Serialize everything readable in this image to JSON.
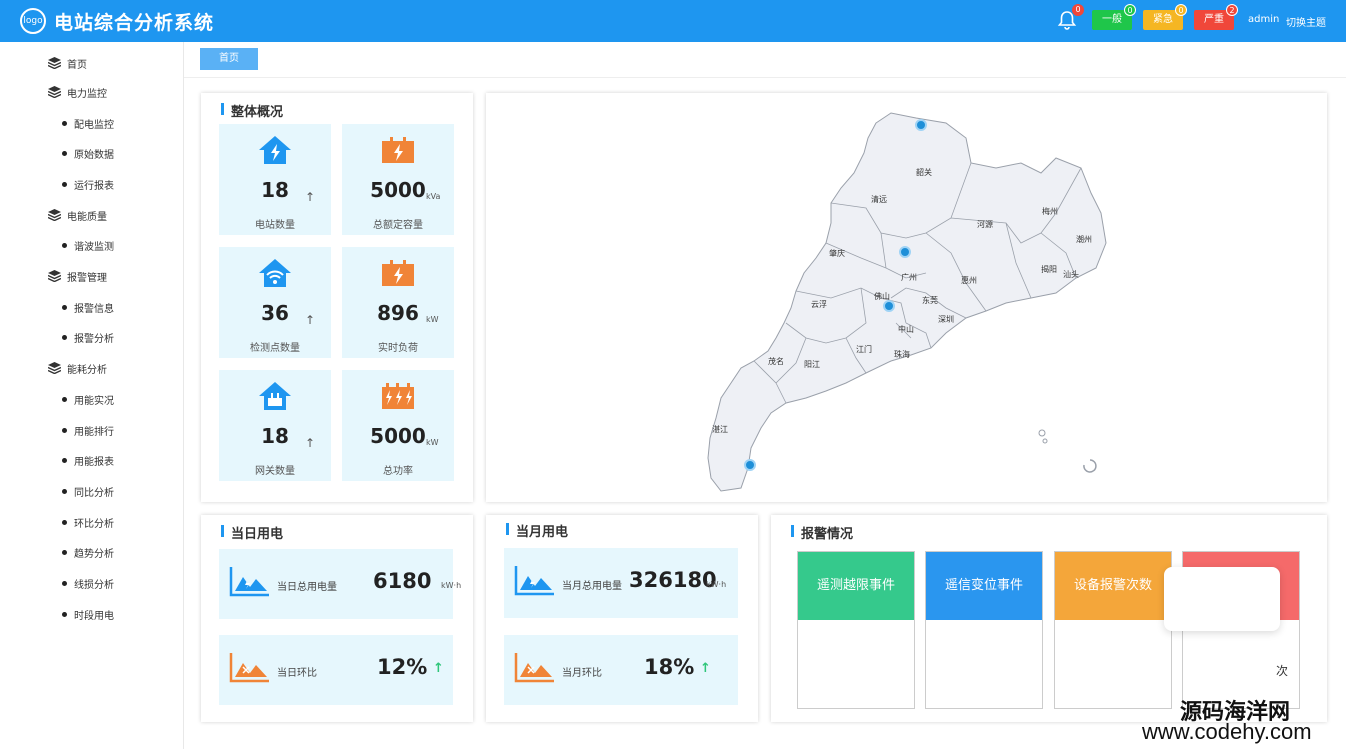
{
  "app": {
    "logo_text": "logo",
    "title": "电站综合分析系统"
  },
  "header": {
    "bell_count": "0",
    "alerts": [
      {
        "label": "一般",
        "count": "0",
        "color": "#1fc64a"
      },
      {
        "label": "紧急",
        "count": "0",
        "color": "#f5b623"
      },
      {
        "label": "严重",
        "count": "2",
        "color": "#f0473a"
      }
    ],
    "user": "admin",
    "theme_switch": "切换主题"
  },
  "sidebar": {
    "items": [
      {
        "label": "首页",
        "level": "top"
      },
      {
        "label": "电力监控",
        "level": "top"
      },
      {
        "label": "配电监控",
        "level": "sub"
      },
      {
        "label": "原始数据",
        "level": "sub"
      },
      {
        "label": "运行报表",
        "level": "sub"
      },
      {
        "label": "电能质量",
        "level": "top"
      },
      {
        "label": "谐波监测",
        "level": "sub"
      },
      {
        "label": "报警管理",
        "level": "top"
      },
      {
        "label": "报警信息",
        "level": "sub"
      },
      {
        "label": "报警分析",
        "level": "sub"
      },
      {
        "label": "能耗分析",
        "level": "top"
      },
      {
        "label": "用能实况",
        "level": "sub"
      },
      {
        "label": "用能排行",
        "level": "sub"
      },
      {
        "label": "用能报表",
        "level": "sub"
      },
      {
        "label": "同比分析",
        "level": "sub"
      },
      {
        "label": "环比分析",
        "level": "sub"
      },
      {
        "label": "趋势分析",
        "level": "sub"
      },
      {
        "label": "线损分析",
        "level": "sub"
      },
      {
        "label": "时段用电",
        "level": "sub"
      }
    ]
  },
  "tabs": {
    "home": "首页"
  },
  "overview": {
    "title": "整体概况",
    "tiles": [
      {
        "value": "18",
        "unit": "",
        "arrow": "↑",
        "label": "电站数量",
        "icon": "house-power-icon"
      },
      {
        "value": "5000",
        "unit": "kVa",
        "arrow": "",
        "label": "总额定容量",
        "icon": "battery-bolt-icon"
      },
      {
        "value": "36",
        "unit": "",
        "arrow": "↑",
        "label": "检测点数量",
        "icon": "house-wifi-icon"
      },
      {
        "value": "896",
        "unit": "kW",
        "arrow": "",
        "label": "实时负荷",
        "icon": "battery-bolt-icon"
      },
      {
        "value": "18",
        "unit": "",
        "arrow": "↑",
        "label": "网关数量",
        "icon": "house-gateway-icon"
      },
      {
        "value": "5000",
        "unit": "kW",
        "arrow": "",
        "label": "总功率",
        "icon": "battery-triple-bolt-icon"
      }
    ]
  },
  "map": {
    "cities": [
      "韶关",
      "清远",
      "河源",
      "梅州",
      "潮州",
      "肇庆",
      "广州",
      "惠州",
      "揭阳",
      "汕头",
      "云浮",
      "佛山",
      "东莞",
      "中山",
      "深圳",
      "江门",
      "珠海",
      "茂名",
      "阳江",
      "湛江"
    ]
  },
  "daily": {
    "title": "当日用电",
    "total_label": "当日总用电量",
    "total_value": "6180",
    "total_unit": "kW·h",
    "ratio_label": "当日环比",
    "ratio_value": "12%",
    "ratio_arrow": "↑"
  },
  "monthly": {
    "title": "当月用电",
    "total_label": "当月总用电量",
    "total_value": "326180",
    "total_unit": "kW·h",
    "ratio_label": "当月环比",
    "ratio_value": "18%",
    "ratio_arrow": "↑"
  },
  "alarms": {
    "title": "报警情况",
    "cards": [
      {
        "label": "遥测越限事件",
        "color": "#35c98c"
      },
      {
        "label": "遥信变位事件",
        "color": "#2a96ef"
      },
      {
        "label": "设备报警次数",
        "color": "#f4a63a"
      },
      {
        "label": "",
        "color": "#f56a6a"
      }
    ],
    "count_suffix": "次"
  },
  "watermark": {
    "line1": "源码海洋网",
    "line2": "www.codehy.com"
  }
}
